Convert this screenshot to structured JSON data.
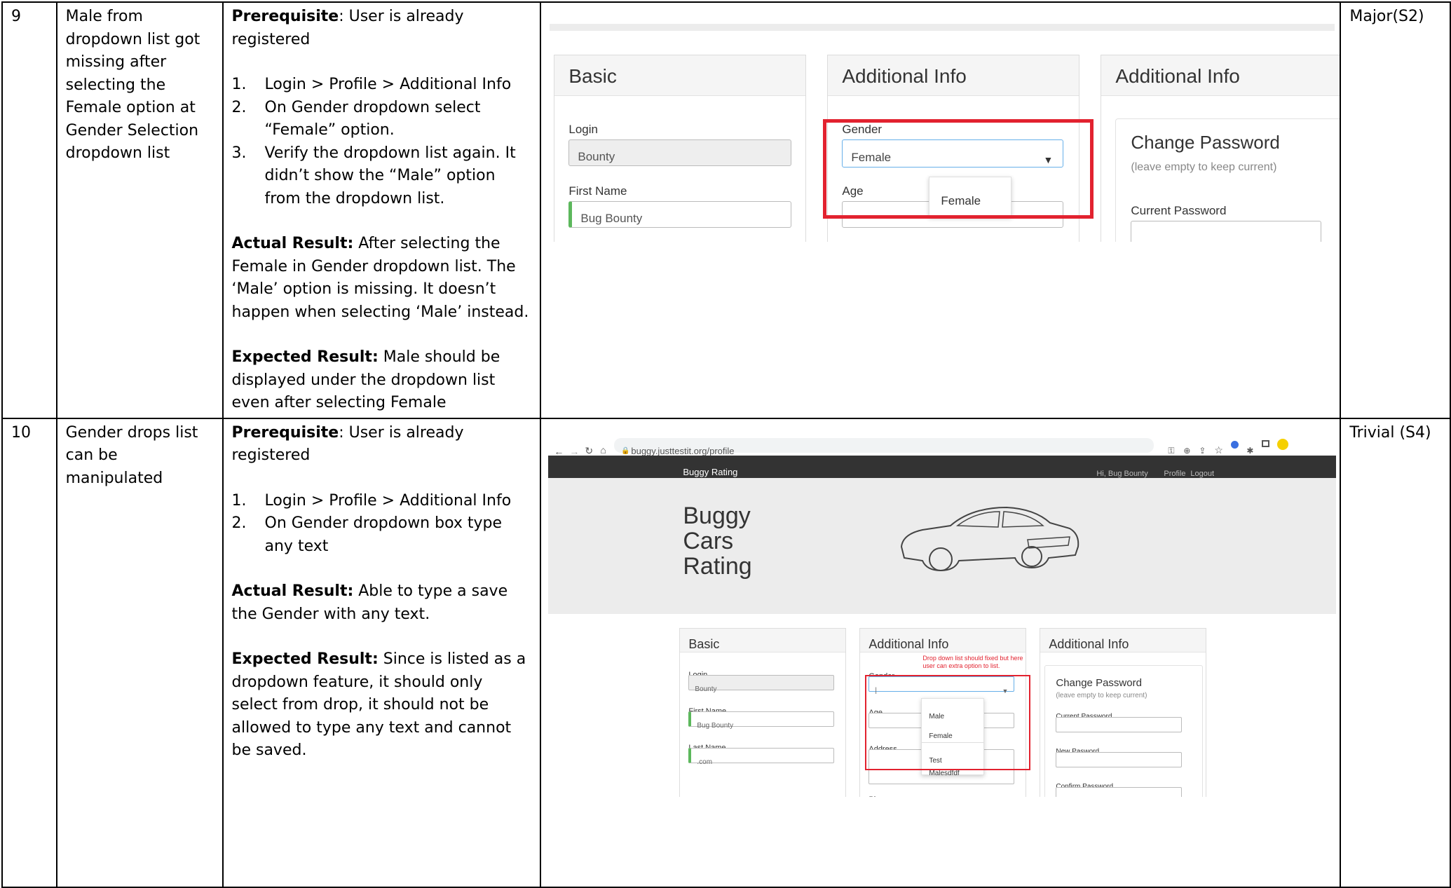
{
  "rows": [
    {
      "id": "9",
      "summary": "Male from dropdown list got missing after selecting the Female option at Gender Selection dropdown list",
      "prereq_label": "Prerequisite",
      "prereq_text": ": User is already registered",
      "steps": [
        {
          "num": "1.",
          "text": "Login > Profile > Additional Info"
        },
        {
          "num": "2.",
          "text": "On Gender dropdown select “Female” option."
        },
        {
          "num": "3.",
          "text": "Verify the dropdown list again. It didn’t show the “Male” option from the dropdown list."
        }
      ],
      "actual_label": "Actual Result:",
      "actual_text": " After selecting the Female in Gender dropdown list.  The ‘Male’ option is missing.  It doesn’t happen when selecting ‘Male’ instead.",
      "expected_label": "Expected Result:",
      "expected_text": " Male should be displayed under the dropdown list even after selecting Female",
      "severity": "Major(S2)",
      "shot": {
        "panel_basic": "Basic",
        "panel_additional": "Additional Info",
        "panel_additional2": "Additional Info",
        "login_label": "Login",
        "login_value": "Bounty",
        "firstname_label": "First Name",
        "firstname_value": "Bug Bounty",
        "gender_label": "Gender",
        "gender_value": "Female",
        "age_label": "Age",
        "dropdown_option": "Female",
        "change_password": "Change Password",
        "change_password_sub": "(leave empty to keep current)",
        "current_password": "Current Password",
        "caret_icon": "▼"
      }
    },
    {
      "id": "10",
      "summary": "Gender drops list can be manipulated",
      "prereq_label": "Prerequisite",
      "prereq_text": ": User is already registered",
      "steps": [
        {
          "num": "1.",
          "text": "Login > Profile > Additional Info"
        },
        {
          "num": "2.",
          "text": "On Gender dropdown box type any text"
        }
      ],
      "actual_label": "Actual Result:",
      "actual_text": " Able to type a save the Gender with any text.",
      "expected_label": "Expected Result:",
      "expected_text": " Since is listed as a dropdown feature, it should only select from drop, it should not be allowed to type any text and cannot be saved.",
      "severity": "Trivial (S4)",
      "shot": {
        "url": "buggy.justtestit.org/profile",
        "brand": "Buggy Rating",
        "nav_greeting": "Hi, Bug Bounty",
        "nav_profile": "Profile",
        "nav_logout": "Logout",
        "hero_line1": "Buggy",
        "hero_line2": "Cars",
        "hero_line3": "Rating",
        "panel_basic": "Basic",
        "panel_additional": "Additional Info",
        "panel_additional2": "Additional Info",
        "login_label": "Login",
        "login_value": "Bounty",
        "firstname_label": "First Name",
        "firstname_value": "Bug Bounty",
        "lastname_label": "Last Name",
        "lastname_value": ".com",
        "gender_label": "Gender",
        "gender_value": "|",
        "age_label": "Age",
        "address_label": "Address",
        "phone_label": "Phone",
        "annotation": "Drop down list should fixed but here user can extra option to list.",
        "options": [
          "Male",
          "Female",
          "Test",
          "Malesdfdf"
        ],
        "change_password": "Change Password",
        "change_password_sub": "(leave empty to keep current)",
        "current_password": "Current Password",
        "new_password": "New Pasword",
        "confirm_password": "Confirm Password",
        "caret_icon": "▼"
      }
    }
  ],
  "colors": {
    "highlight_red": "#e2222f",
    "navbar": "#333333",
    "valid_green": "#5cb85c"
  }
}
